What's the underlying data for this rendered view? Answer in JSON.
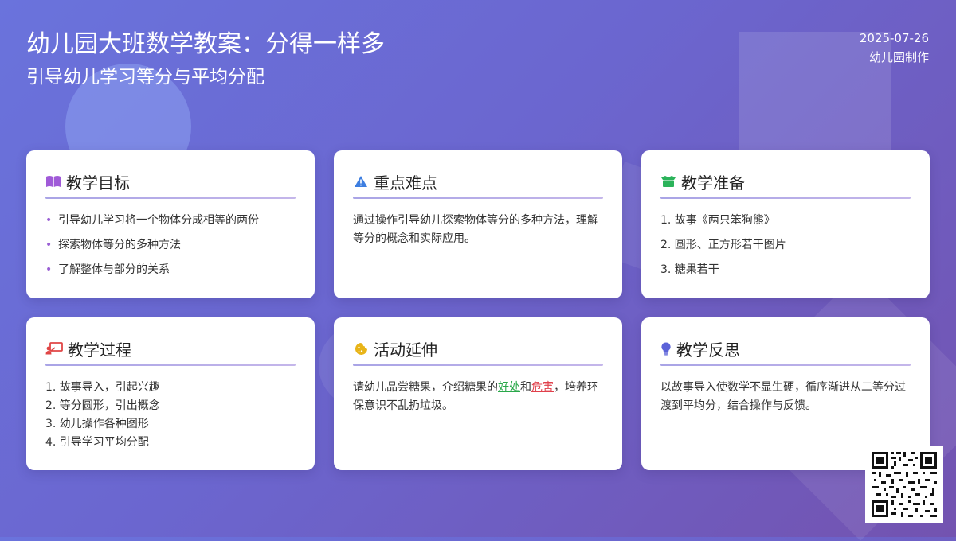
{
  "header": {
    "title": "幼儿园大班数学教案：分得一样多",
    "subtitle": "引导幼儿学习等分与平均分配",
    "date": "2025-07-26",
    "author": "幼儿园制作"
  },
  "colors": {
    "accent": "#9a5fd4",
    "good": "#2aa84a",
    "bad": "#e0404b"
  },
  "cards": {
    "goals": {
      "icon": "book-icon",
      "title": "教学目标",
      "items": [
        "引导幼儿学习将一个物体分成相等的两份",
        "探索物体等分的多种方法",
        "了解整体与部分的关系"
      ]
    },
    "key": {
      "icon": "warning-icon",
      "title": "重点难点",
      "text": "通过操作引导幼儿探索物体等分的多种方法，理解等分的概念和实际应用。"
    },
    "prep": {
      "icon": "box-icon",
      "title": "教学准备",
      "items": [
        "1. 故事《两只笨狗熊》",
        "2. 圆形、正方形若干图片",
        "3. 糖果若干"
      ]
    },
    "process": {
      "icon": "teacher-icon",
      "title": "教学过程",
      "items": [
        "1. 故事导入，引起兴趣",
        "2. 等分圆形，引出概念",
        "3. 幼儿操作各种图形",
        "4. 引导学习平均分配"
      ]
    },
    "extend": {
      "icon": "cookie-icon",
      "title": "活动延伸",
      "text_before": "请幼儿品尝糖果，介绍糖果的",
      "good": "好处",
      "and": "和",
      "bad": "危害",
      "text_after": "，培养环保意识不乱扔垃圾。"
    },
    "reflect": {
      "icon": "lightbulb-icon",
      "title": "教学反思",
      "text": "以故事导入使数学不显生硬，循序渐进从二等分过渡到平均分，结合操作与反馈。"
    }
  }
}
